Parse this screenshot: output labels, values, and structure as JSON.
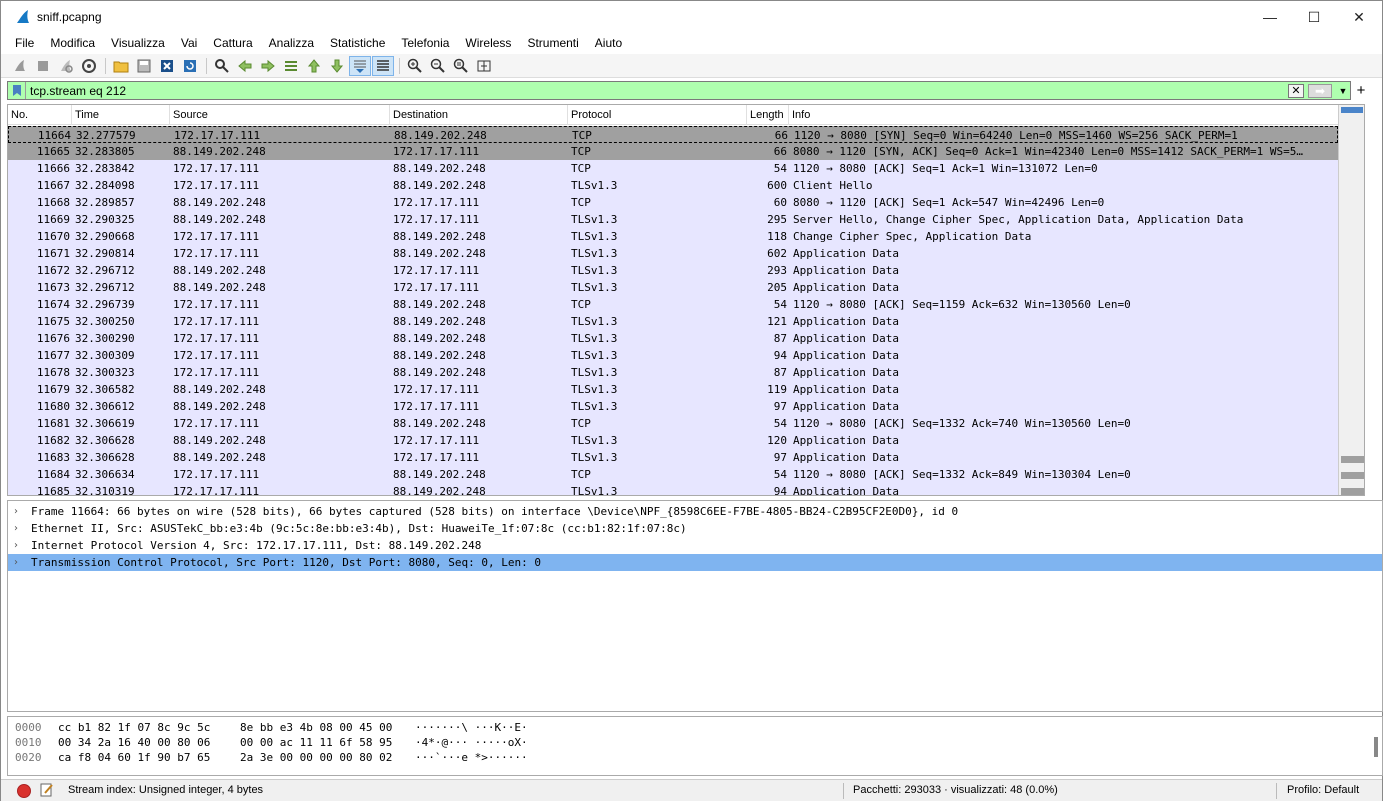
{
  "window": {
    "title": "sniff.pcapng",
    "minimize": "—",
    "maximize": "☐",
    "close": "✕"
  },
  "menu": [
    "File",
    "Modifica",
    "Visualizza",
    "Vai",
    "Cattura",
    "Analizza",
    "Statistiche",
    "Telefonia",
    "Wireless",
    "Strumenti",
    "Aiuto"
  ],
  "toolbar_icons": [
    "start-capture-icon",
    "stop-capture-icon",
    "restart-capture-icon",
    "capture-options-icon",
    "open-file-icon",
    "save-file-icon",
    "close-file-icon",
    "reload-file-icon",
    "find-packet-icon",
    "go-back-icon",
    "go-forward-icon",
    "go-to-packet-icon",
    "first-packet-icon",
    "last-packet-icon",
    "auto-scroll-icon",
    "colorize-icon",
    "zoom-in-icon",
    "zoom-out-icon",
    "normal-size-icon",
    "resize-columns-icon"
  ],
  "filter": {
    "value": "tcp.stream eq 212",
    "plus": "+"
  },
  "columns": [
    "No.",
    "Time",
    "Source",
    "Destination",
    "Protocol",
    "Length",
    "Info"
  ],
  "packets": [
    {
      "no": "11664",
      "time": "32.277579",
      "src": "172.17.17.111",
      "dst": "88.149.202.248",
      "proto": "TCP",
      "len": "66",
      "info": "1120 → 8080 [SYN] Seq=0 Win=64240 Len=0 MSS=1460 WS=256 SACK_PERM=1"
    },
    {
      "no": "11665",
      "time": "32.283805",
      "src": "88.149.202.248",
      "dst": "172.17.17.111",
      "proto": "TCP",
      "len": "66",
      "info": "8080 → 1120 [SYN, ACK] Seq=0 Ack=1 Win=42340 Len=0 MSS=1412 SACK_PERM=1 WS=5…"
    },
    {
      "no": "11666",
      "time": "32.283842",
      "src": "172.17.17.111",
      "dst": "88.149.202.248",
      "proto": "TCP",
      "len": "54",
      "info": "1120 → 8080 [ACK] Seq=1 Ack=1 Win=131072 Len=0"
    },
    {
      "no": "11667",
      "time": "32.284098",
      "src": "172.17.17.111",
      "dst": "88.149.202.248",
      "proto": "TLSv1.3",
      "len": "600",
      "info": "Client Hello"
    },
    {
      "no": "11668",
      "time": "32.289857",
      "src": "88.149.202.248",
      "dst": "172.17.17.111",
      "proto": "TCP",
      "len": "60",
      "info": "8080 → 1120 [ACK] Seq=1 Ack=547 Win=42496 Len=0"
    },
    {
      "no": "11669",
      "time": "32.290325",
      "src": "88.149.202.248",
      "dst": "172.17.17.111",
      "proto": "TLSv1.3",
      "len": "295",
      "info": "Server Hello, Change Cipher Spec, Application Data, Application Data"
    },
    {
      "no": "11670",
      "time": "32.290668",
      "src": "172.17.17.111",
      "dst": "88.149.202.248",
      "proto": "TLSv1.3",
      "len": "118",
      "info": "Change Cipher Spec, Application Data"
    },
    {
      "no": "11671",
      "time": "32.290814",
      "src": "172.17.17.111",
      "dst": "88.149.202.248",
      "proto": "TLSv1.3",
      "len": "602",
      "info": "Application Data"
    },
    {
      "no": "11672",
      "time": "32.296712",
      "src": "88.149.202.248",
      "dst": "172.17.17.111",
      "proto": "TLSv1.3",
      "len": "293",
      "info": "Application Data"
    },
    {
      "no": "11673",
      "time": "32.296712",
      "src": "88.149.202.248",
      "dst": "172.17.17.111",
      "proto": "TLSv1.3",
      "len": "205",
      "info": "Application Data"
    },
    {
      "no": "11674",
      "time": "32.296739",
      "src": "172.17.17.111",
      "dst": "88.149.202.248",
      "proto": "TCP",
      "len": "54",
      "info": "1120 → 8080 [ACK] Seq=1159 Ack=632 Win=130560 Len=0"
    },
    {
      "no": "11675",
      "time": "32.300250",
      "src": "172.17.17.111",
      "dst": "88.149.202.248",
      "proto": "TLSv1.3",
      "len": "121",
      "info": "Application Data"
    },
    {
      "no": "11676",
      "time": "32.300290",
      "src": "172.17.17.111",
      "dst": "88.149.202.248",
      "proto": "TLSv1.3",
      "len": "87",
      "info": "Application Data"
    },
    {
      "no": "11677",
      "time": "32.300309",
      "src": "172.17.17.111",
      "dst": "88.149.202.248",
      "proto": "TLSv1.3",
      "len": "94",
      "info": "Application Data"
    },
    {
      "no": "11678",
      "time": "32.300323",
      "src": "172.17.17.111",
      "dst": "88.149.202.248",
      "proto": "TLSv1.3",
      "len": "87",
      "info": "Application Data"
    },
    {
      "no": "11679",
      "time": "32.306582",
      "src": "88.149.202.248",
      "dst": "172.17.17.111",
      "proto": "TLSv1.3",
      "len": "119",
      "info": "Application Data"
    },
    {
      "no": "11680",
      "time": "32.306612",
      "src": "88.149.202.248",
      "dst": "172.17.17.111",
      "proto": "TLSv1.3",
      "len": "97",
      "info": "Application Data"
    },
    {
      "no": "11681",
      "time": "32.306619",
      "src": "172.17.17.111",
      "dst": "88.149.202.248",
      "proto": "TCP",
      "len": "54",
      "info": "1120 → 8080 [ACK] Seq=1332 Ack=740 Win=130560 Len=0"
    },
    {
      "no": "11682",
      "time": "32.306628",
      "src": "88.149.202.248",
      "dst": "172.17.17.111",
      "proto": "TLSv1.3",
      "len": "120",
      "info": "Application Data"
    },
    {
      "no": "11683",
      "time": "32.306628",
      "src": "88.149.202.248",
      "dst": "172.17.17.111",
      "proto": "TLSv1.3",
      "len": "97",
      "info": "Application Data"
    },
    {
      "no": "11684",
      "time": "32.306634",
      "src": "172.17.17.111",
      "dst": "88.149.202.248",
      "proto": "TCP",
      "len": "54",
      "info": "1120 → 8080 [ACK] Seq=1332 Ack=849 Win=130304 Len=0"
    },
    {
      "no": "11685",
      "time": "32.310319",
      "src": "172.17.17.111",
      "dst": "88.149.202.248",
      "proto": "TLSv1.3",
      "len": "94",
      "info": "Application Data"
    }
  ],
  "details": [
    "Frame 11664: 66 bytes on wire (528 bits), 66 bytes captured (528 bits) on interface \\Device\\NPF_{8598C6EE-F7BE-4805-BB24-C2B95CF2E0D0}, id 0",
    "Ethernet II, Src: ASUSTekC_bb:e3:4b (9c:5c:8e:bb:e3:4b), Dst: HuaweiTe_1f:07:8c (cc:b1:82:1f:07:8c)",
    "Internet Protocol Version 4, Src: 172.17.17.111, Dst: 88.149.202.248",
    "Transmission Control Protocol, Src Port: 1120, Dst Port: 8080, Seq: 0, Len: 0"
  ],
  "bytes": [
    {
      "offset": "0000",
      "hex1": "cc b1 82 1f 07 8c 9c 5c",
      "hex2": "8e bb e3 4b 08 00 45 00",
      "ascii": "·······\\ ···K··E·"
    },
    {
      "offset": "0010",
      "hex1": "00 34 2a 16 40 00 80 06",
      "hex2": "00 00 ac 11 11 6f 58 95",
      "ascii": "·4*·@··· ·····oX·"
    },
    {
      "offset": "0020",
      "hex1": "ca f8 04 60 1f 90 b7 65",
      "hex2": "2a 3e 00 00 00 00 80 02",
      "ascii": "···`···e *>······"
    }
  ],
  "status": {
    "field": "Stream index: Unsigned integer, 4 bytes",
    "packets": "Pacchetti: 293033 · visualizzati: 48 (0.0%)",
    "profile": "Profilo: Default"
  },
  "colors": {
    "filter_bg": "#afffaf",
    "row_bg": "#e7e6ff",
    "syn_row_bg": "#a0a0a0",
    "detail_selected": "#7fb4f0"
  }
}
